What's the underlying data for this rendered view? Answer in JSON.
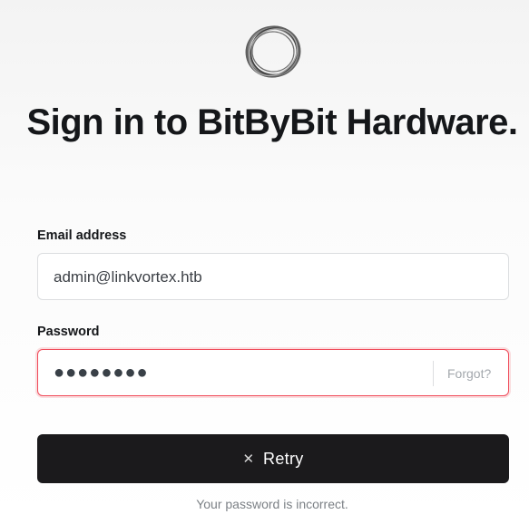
{
  "header": {
    "logo_icon": "ring-logo-icon",
    "title": "Sign in to BitByBit Hardware."
  },
  "form": {
    "email_label": "Email address",
    "email_value": "admin@linkvortex.htb",
    "password_label": "Password",
    "password_masked": "●●●●●●●●",
    "forgot_label": "Forgot?",
    "submit_icon": "close-icon",
    "submit_label": "Retry",
    "error_message": "Your password is incorrect."
  },
  "colors": {
    "button_background": "#1b1a1c",
    "error_border": "#f04b5a"
  }
}
